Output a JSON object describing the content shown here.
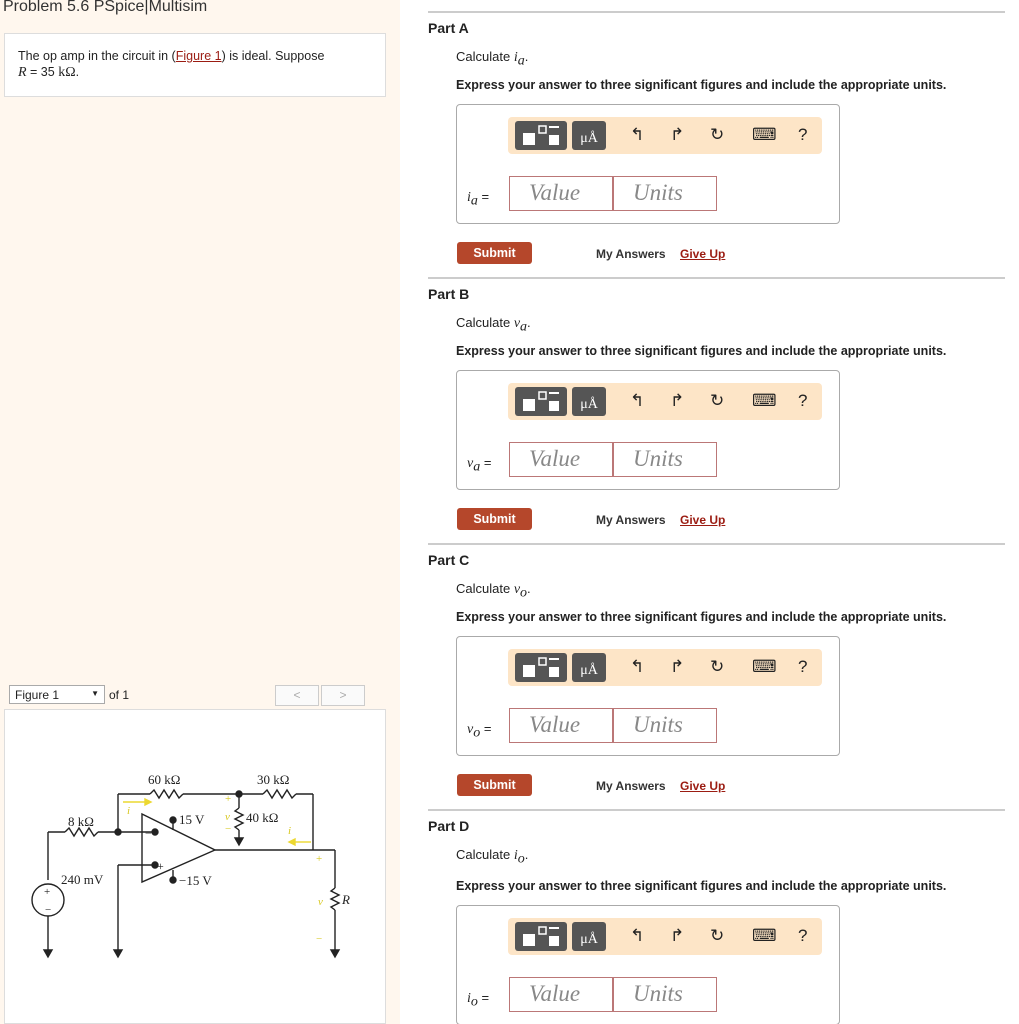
{
  "problem": {
    "title": "Problem 5.6 PSpice|Multisim",
    "text_before": "The op amp in the circuit in (",
    "figure_link": "Figure 1",
    "text_after": ") is ideal. Suppose",
    "r_var": "R",
    "r_eq": " = 35 ",
    "r_unit": "kΩ",
    "r_end": "."
  },
  "figure_nav": {
    "selected": "Figure 1",
    "of_text": "of 1",
    "prev": "<",
    "next": ">"
  },
  "circuit": {
    "r1": "8 kΩ",
    "r2": "60 kΩ",
    "r3": "30 kΩ",
    "r4": "40 kΩ",
    "r_load": "R",
    "vs": "240 mV",
    "vpos": "15 V",
    "vneg": "−15 V",
    "ia": "i",
    "ia_sub": "a",
    "va": "v",
    "va_sub": "a",
    "io": "i",
    "io_sub": "o",
    "vo": "v",
    "vo_sub": "o",
    "plus": "+",
    "minus": "−",
    "amp_plus": "+",
    "amp_minus": "−"
  },
  "common": {
    "calc_prefix": "Calculate ",
    "express": "Express your answer to three significant figures and include the appropriate units.",
    "value_placeholder": "Value",
    "units_placeholder": "Units",
    "submit": "Submit",
    "my_answers": "My Answers",
    "give_up": "Give Up",
    "unit_btn": "μÅ",
    "undo": "↰",
    "redo": "↱",
    "reset": "↻",
    "keyboard": "⌨",
    "help": "?"
  },
  "parts": [
    {
      "title": "Part A",
      "var": "i",
      "sub": "a",
      "eq": " ="
    },
    {
      "title": "Part B",
      "var": "v",
      "sub": "a",
      "eq": " ="
    },
    {
      "title": "Part C",
      "var": "v",
      "sub": "o",
      "eq": " ="
    },
    {
      "title": "Part D",
      "var": "i",
      "sub": "o",
      "eq": " ="
    }
  ]
}
